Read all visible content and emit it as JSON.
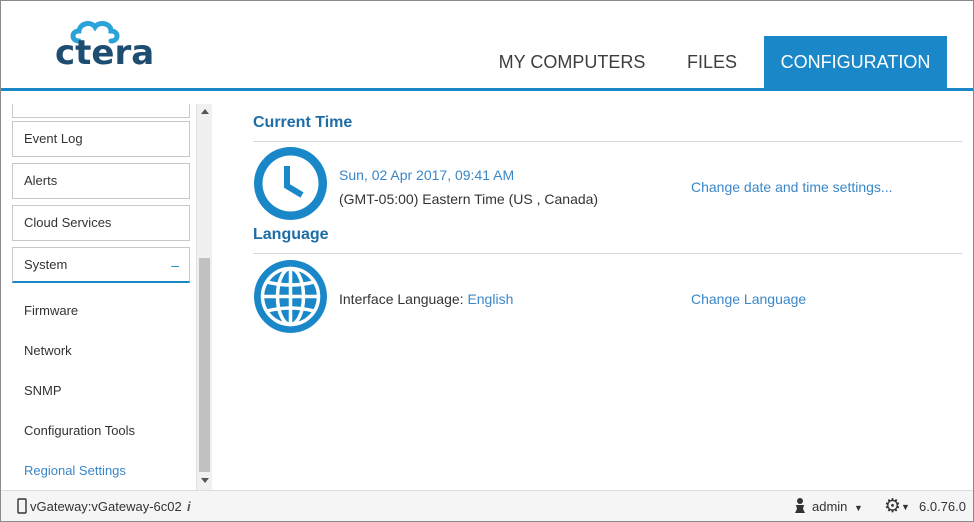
{
  "brand": {
    "logo_text": "ctera"
  },
  "nav": {
    "tabs": [
      {
        "label": "MY COMPUTERS"
      },
      {
        "label": "FILES"
      },
      {
        "label": "CONFIGURATION"
      }
    ]
  },
  "sidebar": {
    "items": [
      {
        "label": "Event Log"
      },
      {
        "label": "Alerts"
      },
      {
        "label": "Cloud Services"
      },
      {
        "label": "System",
        "collapse_symbol": "–"
      }
    ],
    "sub_items": [
      {
        "label": "Firmware"
      },
      {
        "label": "Network"
      },
      {
        "label": "SNMP"
      },
      {
        "label": "Configuration Tools"
      },
      {
        "label": "Regional Settings"
      }
    ]
  },
  "current_time": {
    "title": "Current Time",
    "icon": "clock-icon",
    "datetime": "Sun, 02 Apr 2017, 09:41 AM",
    "timezone": "(GMT-05:00) Eastern Time (US , Canada)",
    "action": "Change date and time settings..."
  },
  "language": {
    "title": "Language",
    "icon": "globe-icon",
    "label": "Interface Language:",
    "value": "English",
    "action": "Change Language"
  },
  "footer": {
    "device": "vGateway:vGateway-6c02",
    "info_symbol": "i",
    "user": "admin",
    "version": "6.0.76.0"
  },
  "colors": {
    "accent": "#1a88c8",
    "title": "#1f6da6",
    "link": "#3a87c8",
    "logo_dark": "#1e4d72"
  }
}
